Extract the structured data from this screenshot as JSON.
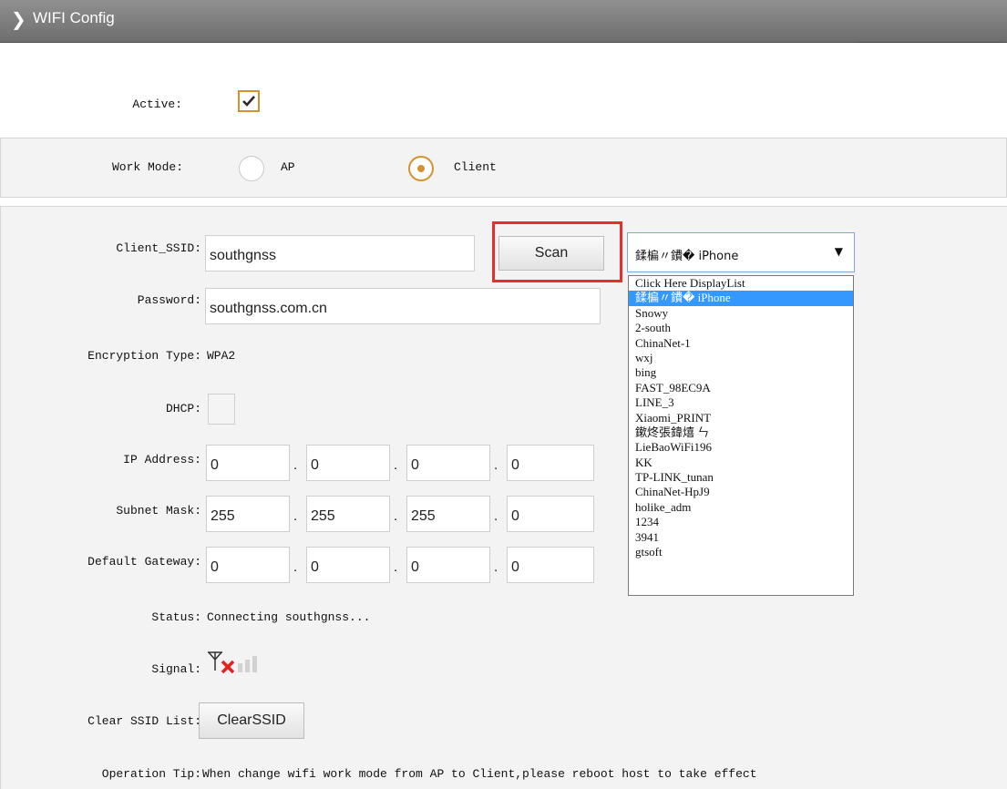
{
  "header": {
    "title": "WIFI Config",
    "icon": "chevron-right-icon"
  },
  "active": {
    "label": "Active:",
    "checked": true
  },
  "work_mode": {
    "label": "Work Mode:",
    "options": [
      {
        "label": "AP",
        "selected": false
      },
      {
        "label": "Client",
        "selected": true
      }
    ]
  },
  "client": {
    "ssid_label": "Client_SSID:",
    "ssid_value": "southgnss",
    "scan_label": "Scan",
    "password_label": "Password:",
    "password_value": "southgnss.com.cn",
    "encryption_label": "Encryption Type:",
    "encryption_value": "WPA2",
    "dhcp_label": "DHCP:",
    "dhcp_checked": false,
    "ip_label": "IP Address:",
    "ip": [
      "0",
      "0",
      "0",
      "0"
    ],
    "mask_label": "Subnet Mask:",
    "mask": [
      "255",
      "255",
      "255",
      "0"
    ],
    "gateway_label": "Default Gateway:",
    "gateway": [
      "0",
      "0",
      "0",
      "0"
    ],
    "status_label": "Status:",
    "status_value": "Connecting southgnss...",
    "signal_label": "Signal:",
    "signal_state": "disconnected",
    "clear_label": "Clear SSID List:",
    "clear_button": "ClearSSID",
    "tip_label": "Operation Tip:",
    "tip_value": "When change wifi work mode from AP to Client,please reboot host to take effect"
  },
  "ssid_select": {
    "selected": "鍒楄〃鐨� iPhone",
    "options": [
      "Click Here DisplayList",
      "鍒楄〃鐨� iPhone",
      "Snowy",
      "2-south",
      "ChinaNet-1",
      "wxj",
      "bing",
      "FAST_98EC9A",
      "LINE_3",
      "Xiaomi_PRINT",
      "鏉炵張鍏熺 ㄣ",
      "LieBaoWiFi196",
      "KK",
      "TP-LINK_tunan",
      "ChinaNet-HpJ9",
      "holike_adm",
      "1234",
      "3941",
      "gtsoft"
    ],
    "highlighted_index": 1
  },
  "colors": {
    "accent": "#d4912f",
    "highlight_box": "#e2322b",
    "list_selection": "#3399ff",
    "header": "#7d7d7d"
  }
}
